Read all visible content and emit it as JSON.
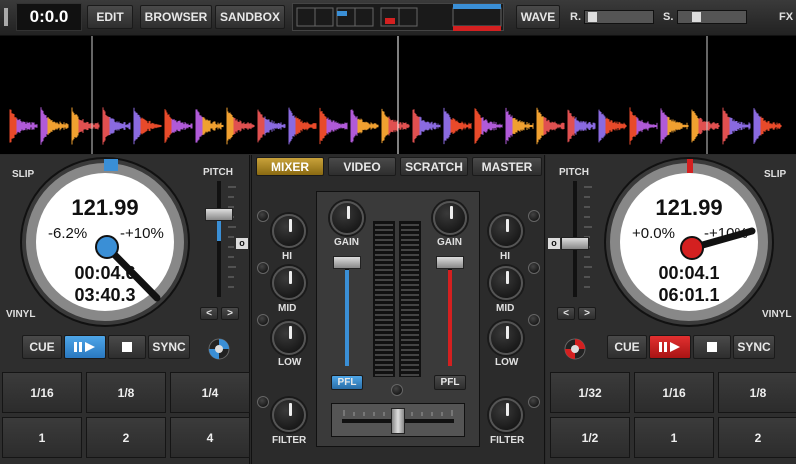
{
  "topbar": {
    "time": "0:0.0",
    "edit": "EDIT",
    "browser": "BROWSER",
    "sandbox": "SANDBOX",
    "wave": "WAVE",
    "rec_label": "R.",
    "sampler_label": "S.",
    "fx": "FX"
  },
  "center": {
    "tabs": [
      "MIXER",
      "VIDEO",
      "SCRATCH",
      "MASTER"
    ],
    "left": {
      "gain": "GAIN",
      "hi": "HI",
      "mid": "MID",
      "low": "LOW",
      "filter": "FILTER",
      "pfl": "PFL"
    },
    "right": {
      "gain": "GAIN",
      "hi": "HI",
      "mid": "MID",
      "low": "LOW",
      "filter": "FILTER",
      "pfl": "PFL"
    }
  },
  "deck_left": {
    "slip": "SLIP",
    "vinyl": "VINYL",
    "pitch": "PITCH",
    "bpm": "121.99",
    "pitch_pct": "-6.2%",
    "range": "-+10%",
    "elapsed": "00:04.6",
    "remaining": "03:40.3",
    "cue": "CUE",
    "sync": "SYNC",
    "nav_prev": "<",
    "nav_next": ">",
    "zero": "o",
    "pads": [
      "1/16",
      "1/8",
      "1/4",
      "1",
      "2",
      "4"
    ],
    "accent": "#3a8fd6"
  },
  "deck_right": {
    "slip": "SLIP",
    "vinyl": "VINYL",
    "pitch": "PITCH",
    "bpm": "121.99",
    "pitch_pct": "+0.0%",
    "range": "-+10%",
    "elapsed": "00:04.1",
    "remaining": "06:01.1",
    "cue": "CUE",
    "sync": "SYNC",
    "nav_prev": "<",
    "nav_next": ">",
    "zero": "o",
    "pads": [
      "1/32",
      "1/16",
      "1/8",
      "1/2",
      "1",
      "2"
    ],
    "accent": "#d42020"
  }
}
